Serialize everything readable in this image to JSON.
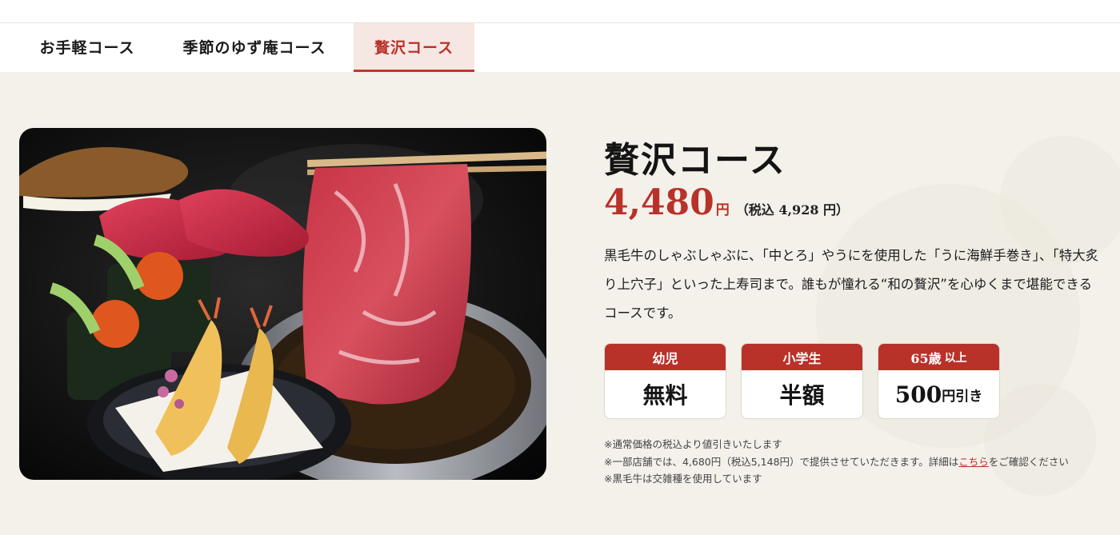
{
  "tabs": [
    {
      "label": "お手軽コース"
    },
    {
      "label": "季節のゆず庵コース"
    },
    {
      "label": "贅沢コース"
    }
  ],
  "active_tab": "贅沢コース",
  "course": {
    "title": "贅沢コース",
    "price": "4,480",
    "price_unit": "円",
    "price_tax": "（税込 4,928 円）",
    "description": "黒毛牛のしゃぶしゃぶに、「中とろ」やうにを使用した「うに海鮮手巻き」、「特大炙り上穴子」といった上寿司まで。誰もが憧れる“和の贅沢”を心ゆくまで堪能できるコースです。"
  },
  "pricing": [
    {
      "label": "幼児",
      "value": "無料"
    },
    {
      "label": "小学生",
      "value": "半額"
    },
    {
      "label": "65歳",
      "label_suffix": "以上",
      "value": "500",
      "value_suffix": "円引き"
    }
  ],
  "notes": {
    "note1": "※通常価格の税込より値引きいたします",
    "note2_before": "※一部店舗では、4,680円（税込5,148円）で提供させていただきます。詳細は",
    "note2_link": "こちら",
    "note2_after": "をご確認ください",
    "note3": "※黒毛牛は交雑種を使用しています"
  },
  "colors": {
    "accent": "#b8322a",
    "background": "#f3f1ea",
    "active_tab_bg": "#f6e7e3"
  }
}
